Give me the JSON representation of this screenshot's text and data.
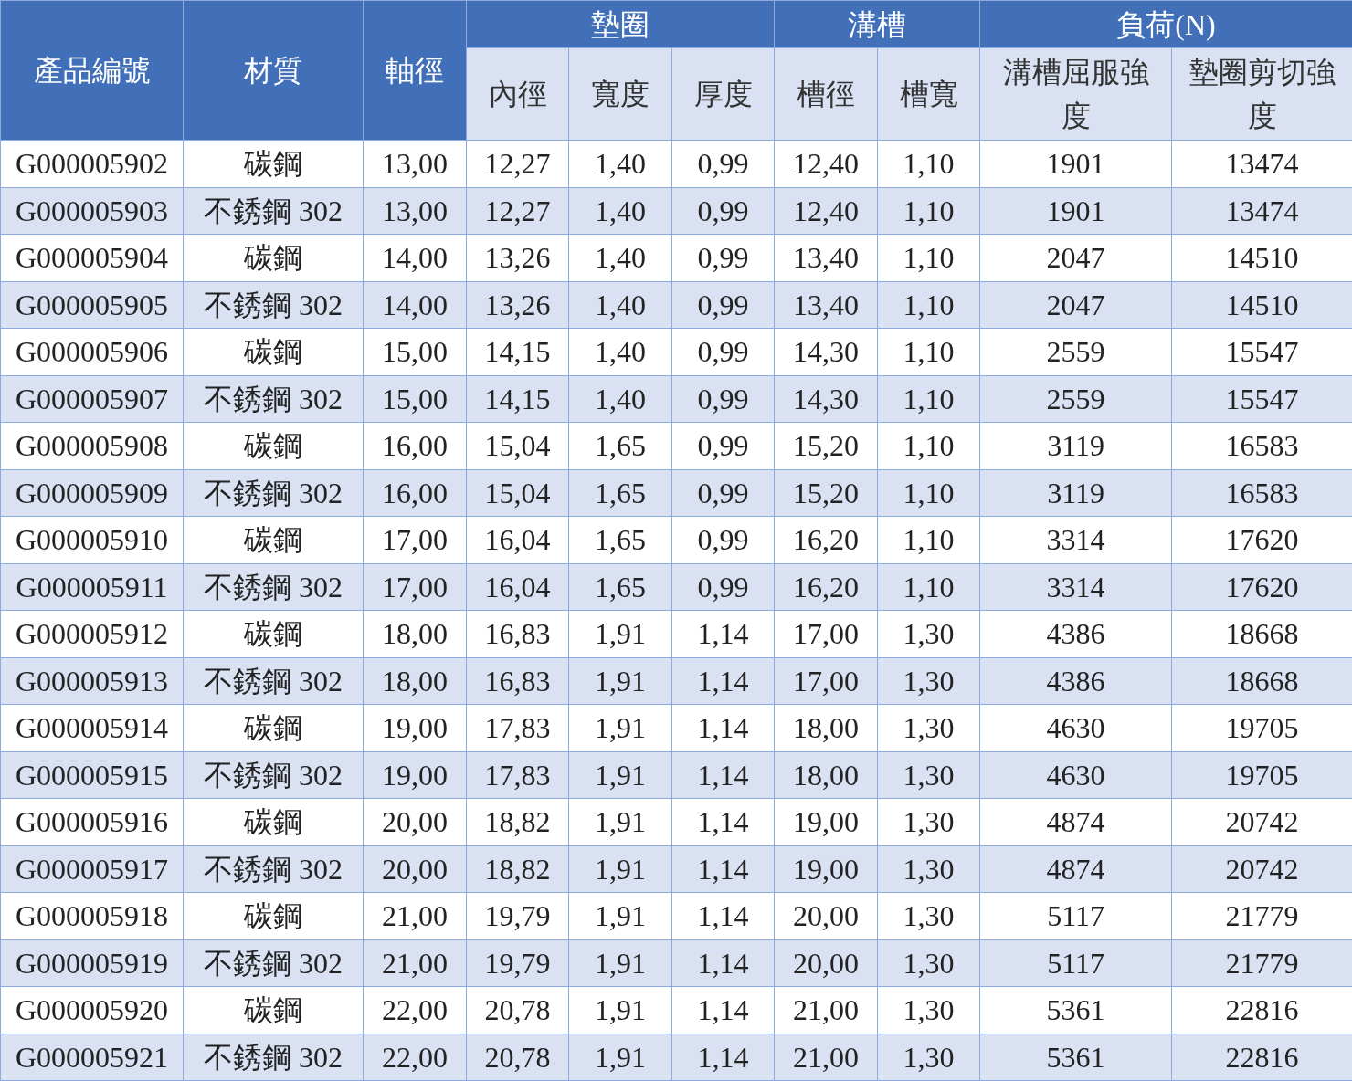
{
  "table": {
    "header": [
      {
        "label": "產品編號"
      },
      {
        "label": "材質"
      },
      {
        "label": "軸徑"
      },
      {
        "label": "墊圈",
        "subcolumns": [
          "內徑",
          "寬度",
          "厚度"
        ]
      },
      {
        "label": "溝槽",
        "subcolumns": [
          "槽徑",
          "槽寬"
        ]
      },
      {
        "label": "負荷(N)",
        "subcolumns": [
          "溝槽屈服強度",
          "墊圈剪切強度"
        ]
      }
    ],
    "rows": [
      [
        "G000005902",
        "碳鋼",
        "13,00",
        "12,27",
        "1,40",
        "0,99",
        "12,40",
        "1,10",
        "1901",
        "13474"
      ],
      [
        "G000005903",
        "不銹鋼 302",
        "13,00",
        "12,27",
        "1,40",
        "0,99",
        "12,40",
        "1,10",
        "1901",
        "13474"
      ],
      [
        "G000005904",
        "碳鋼",
        "14,00",
        "13,26",
        "1,40",
        "0,99",
        "13,40",
        "1,10",
        "2047",
        "14510"
      ],
      [
        "G000005905",
        "不銹鋼 302",
        "14,00",
        "13,26",
        "1,40",
        "0,99",
        "13,40",
        "1,10",
        "2047",
        "14510"
      ],
      [
        "G000005906",
        "碳鋼",
        "15,00",
        "14,15",
        "1,40",
        "0,99",
        "14,30",
        "1,10",
        "2559",
        "15547"
      ],
      [
        "G000005907",
        "不銹鋼 302",
        "15,00",
        "14,15",
        "1,40",
        "0,99",
        "14,30",
        "1,10",
        "2559",
        "15547"
      ],
      [
        "G000005908",
        "碳鋼",
        "16,00",
        "15,04",
        "1,65",
        "0,99",
        "15,20",
        "1,10",
        "3119",
        "16583"
      ],
      [
        "G000005909",
        "不銹鋼 302",
        "16,00",
        "15,04",
        "1,65",
        "0,99",
        "15,20",
        "1,10",
        "3119",
        "16583"
      ],
      [
        "G000005910",
        "碳鋼",
        "17,00",
        "16,04",
        "1,65",
        "0,99",
        "16,20",
        "1,10",
        "3314",
        "17620"
      ],
      [
        "G000005911",
        "不銹鋼 302",
        "17,00",
        "16,04",
        "1,65",
        "0,99",
        "16,20",
        "1,10",
        "3314",
        "17620"
      ],
      [
        "G000005912",
        "碳鋼",
        "18,00",
        "16,83",
        "1,91",
        "1,14",
        "17,00",
        "1,30",
        "4386",
        "18668"
      ],
      [
        "G000005913",
        "不銹鋼 302",
        "18,00",
        "16,83",
        "1,91",
        "1,14",
        "17,00",
        "1,30",
        "4386",
        "18668"
      ],
      [
        "G000005914",
        "碳鋼",
        "19,00",
        "17,83",
        "1,91",
        "1,14",
        "18,00",
        "1,30",
        "4630",
        "19705"
      ],
      [
        "G000005915",
        "不銹鋼 302",
        "19,00",
        "17,83",
        "1,91",
        "1,14",
        "18,00",
        "1,30",
        "4630",
        "19705"
      ],
      [
        "G000005916",
        "碳鋼",
        "20,00",
        "18,82",
        "1,91",
        "1,14",
        "19,00",
        "1,30",
        "4874",
        "20742"
      ],
      [
        "G000005917",
        "不銹鋼 302",
        "20,00",
        "18,82",
        "1,91",
        "1,14",
        "19,00",
        "1,30",
        "4874",
        "20742"
      ],
      [
        "G000005918",
        "碳鋼",
        "21,00",
        "19,79",
        "1,91",
        "1,14",
        "20,00",
        "1,30",
        "5117",
        "21779"
      ],
      [
        "G000005919",
        "不銹鋼 302",
        "21,00",
        "19,79",
        "1,91",
        "1,14",
        "20,00",
        "1,30",
        "5117",
        "21779"
      ],
      [
        "G000005920",
        "碳鋼",
        "22,00",
        "20,78",
        "1,91",
        "1,14",
        "21,00",
        "1,30",
        "5361",
        "22816"
      ],
      [
        "G000005921",
        "不銹鋼 302",
        "22,00",
        "20,78",
        "1,91",
        "1,14",
        "21,00",
        "1,30",
        "5361",
        "22816"
      ]
    ]
  }
}
